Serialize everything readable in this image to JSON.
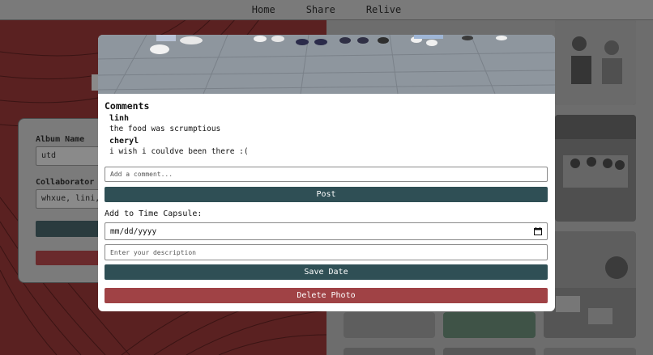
{
  "nav": {
    "links": [
      "Home",
      "Share",
      "Relive"
    ]
  },
  "album": {
    "name_label": "Album Name",
    "name_value": "utd",
    "collab_label": "Collaborator Us",
    "collab_value": "whxue, lini, s"
  },
  "modal": {
    "comments_title": "Comments",
    "comments": [
      {
        "author": "linh",
        "text": "the food was scrumptious"
      },
      {
        "author": "cheryl",
        "text": "i wish i couldve been there :("
      }
    ],
    "comment_placeholder": "Add a comment...",
    "post_label": "Post",
    "capsule_label": "Add to Time Capsule:",
    "date_value": "mm/dd/yyyy",
    "description_placeholder": "Enter your description",
    "save_label": "Save Date",
    "delete_label": "Delete Photo"
  },
  "colors": {
    "primary": "#2f4f55",
    "danger": "#a04245",
    "background_red": "#5a2121"
  },
  "icons": {
    "date": "calendar-icon"
  }
}
